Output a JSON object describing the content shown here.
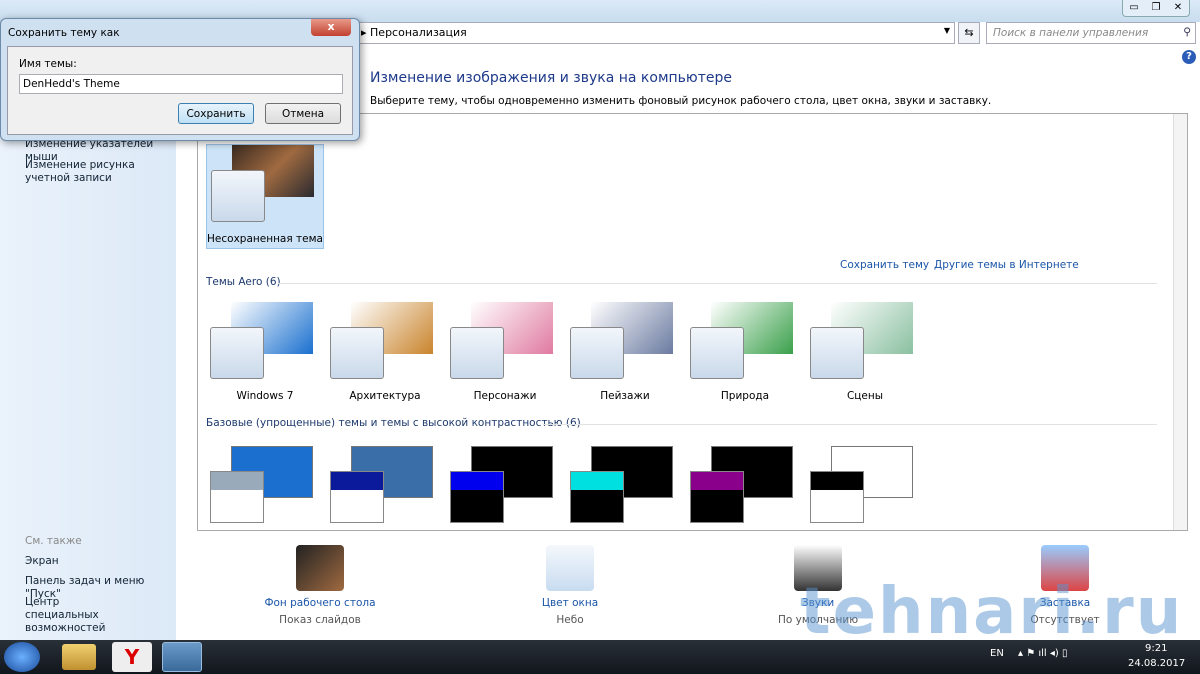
{
  "window": {
    "breadcrumb_current": "Персонализация",
    "search_placeholder": "Поиск в панели управления",
    "title": "Изменение изображения и звука на компьютере",
    "subtitle": "Выберите тему, чтобы одновременно изменить фоновый рисунок рабочего стола, цвет окна, звуки и заставку."
  },
  "sidebar": {
    "items": [
      {
        "label": "Изменение указателей мыши"
      },
      {
        "label": "Изменение рисунка учетной записи"
      }
    ],
    "see_also": "См. также",
    "links": [
      {
        "label": "Экран"
      },
      {
        "label": "Панель задач и меню \"Пуск\""
      },
      {
        "label": "Центр специальных возможностей"
      }
    ]
  },
  "themes": {
    "my_theme": "Несохраненная тема",
    "save_link": "Сохранить тему",
    "online_link": "Другие темы в Интернете",
    "aero_header": "Темы Aero (6)",
    "aero": [
      {
        "label": "Windows 7",
        "color": "#1a6fcf"
      },
      {
        "label": "Архитектура",
        "color": "#c9842c"
      },
      {
        "label": "Персонажи",
        "color": "#e07aa0"
      },
      {
        "label": "Пейзажи",
        "color": "#6a7aa0"
      },
      {
        "label": "Природа",
        "color": "#3aa04a"
      },
      {
        "label": "Сцены",
        "color": "#8ac0a0"
      }
    ],
    "basic_header": "Базовые (упрощенные) темы и темы с высокой контрастностью (6)",
    "basic": [
      {
        "bg": "#1a6fcf",
        "bar": "#9ab"
      },
      {
        "bg": "#3a6ea8",
        "bar": "#0a1a9a"
      },
      {
        "bg": "#000000",
        "bar": "#0000ee"
      },
      {
        "bg": "#000000",
        "bar": "#00e0e0"
      },
      {
        "bg": "#000000",
        "bar": "#8a008a"
      },
      {
        "bg": "#ffffff",
        "bar": "#000000"
      }
    ]
  },
  "bottom": [
    {
      "label": "Фон рабочего стола",
      "value": "Показ слайдов"
    },
    {
      "label": "Цвет окна",
      "value": "Небо"
    },
    {
      "label": "Звуки",
      "value": "По умолчанию"
    },
    {
      "label": "Заставка",
      "value": "Отсутствует"
    }
  ],
  "taskbar": {
    "lang": "EN",
    "time": "9:21",
    "date": "24.08.2017"
  },
  "dialog": {
    "title": "Сохранить тему как",
    "label": "Имя темы:",
    "value": "DenHedd's Theme",
    "save": "Сохранить",
    "cancel": "Отмена"
  },
  "watermark": "tehnari.ru"
}
